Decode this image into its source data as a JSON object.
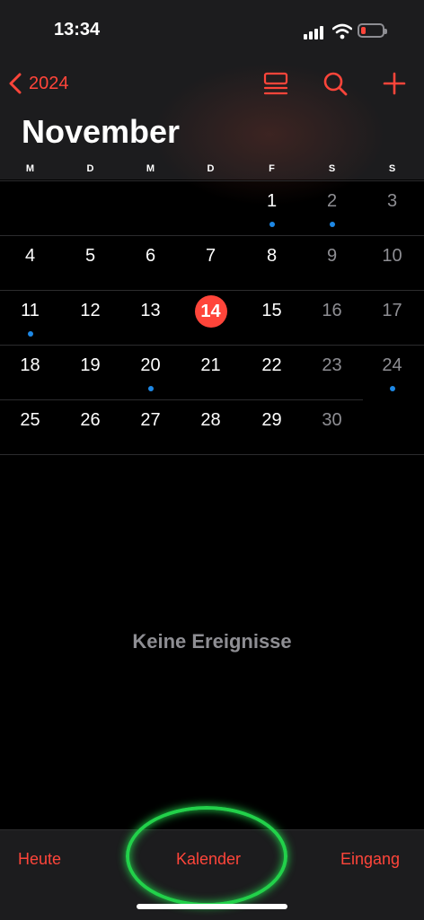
{
  "status": {
    "time": "13:34"
  },
  "nav": {
    "back_label": "2024",
    "month_title": "November"
  },
  "colors": {
    "accent": "#ff453a",
    "event_dot": "#1e88e5",
    "highlight": "#22d14a"
  },
  "weekdays": [
    "M",
    "D",
    "M",
    "D",
    "F",
    "S",
    "S"
  ],
  "days": [
    "1",
    "2",
    "3",
    "4",
    "5",
    "6",
    "7",
    "8",
    "9",
    "10",
    "11",
    "12",
    "13",
    "14",
    "15",
    "16",
    "17",
    "18",
    "19",
    "20",
    "21",
    "22",
    "23",
    "24",
    "25",
    "26",
    "27",
    "28",
    "29",
    "30"
  ],
  "today": "14",
  "empty_state": "Keine Ereignisse",
  "tabs": {
    "today": "Heute",
    "calendar": "Kalender",
    "inbox": "Eingang"
  }
}
